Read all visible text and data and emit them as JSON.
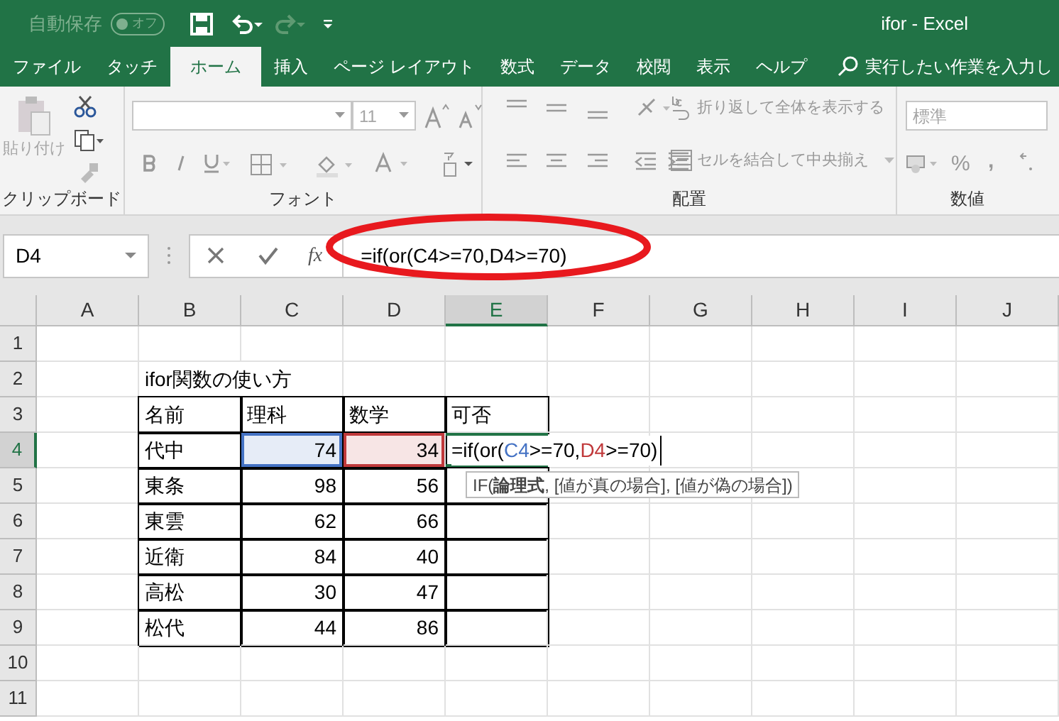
{
  "title_bar": {
    "autosave_label": "自動保存",
    "autosave_toggle": {
      "label": "オフ",
      "on": false
    },
    "redo_disabled": true,
    "title": "ifor  -  Excel"
  },
  "tabs": [
    {
      "label": "ファイル",
      "selected": false
    },
    {
      "label": "タッチ",
      "selected": false
    },
    {
      "label": "ホーム",
      "selected": true
    },
    {
      "label": "挿入",
      "selected": false
    },
    {
      "label": "ページ レイアウト",
      "selected": false
    },
    {
      "label": "数式",
      "selected": false
    },
    {
      "label": "データ",
      "selected": false
    },
    {
      "label": "校閲",
      "selected": false
    },
    {
      "label": "表示",
      "selected": false
    },
    {
      "label": "ヘルプ",
      "selected": false
    }
  ],
  "search": {
    "placeholder": "実行したい作業を入力し"
  },
  "ribbon": {
    "paste_label": "貼り付け",
    "font_size": "11",
    "wrap_text": "折り返して全体を表示する",
    "merge_center": "セルを結合して中央揃え",
    "number_format": "標準",
    "percent": "%",
    "comma": ",",
    "groups": [
      "クリップボード",
      "フォント",
      "配置",
      "数値"
    ]
  },
  "formula_bar": {
    "name_box": "D4",
    "fx": "fx",
    "formula": "=if(or(C4>=70,D4>=70)"
  },
  "columns": [
    {
      "label": "A",
      "selected": false
    },
    {
      "label": "B",
      "selected": false
    },
    {
      "label": "C",
      "selected": false
    },
    {
      "label": "D",
      "selected": false
    },
    {
      "label": "E",
      "selected": true
    },
    {
      "label": "F",
      "selected": false
    },
    {
      "label": "G",
      "selected": false
    },
    {
      "label": "H",
      "selected": false
    },
    {
      "label": "I",
      "selected": false
    },
    {
      "label": "J",
      "selected": false
    }
  ],
  "rows": [
    {
      "label": "1",
      "selected": false,
      "cells": []
    },
    {
      "label": "2",
      "selected": false,
      "cells": [
        {
          "kind": "blank"
        },
        {
          "kind": "text",
          "text": "ifor関数の使い方"
        }
      ]
    },
    {
      "label": "3",
      "selected": false,
      "cells": [
        {
          "kind": "blank"
        },
        {
          "kind": "text",
          "text": "名前",
          "boxed": true
        },
        {
          "kind": "text",
          "text": "理科",
          "boxed": true
        },
        {
          "kind": "text",
          "text": "数学",
          "boxed": true
        },
        {
          "kind": "text",
          "text": "可否",
          "boxed": true
        }
      ]
    },
    {
      "label": "4",
      "selected": true,
      "cells": [
        {
          "kind": "blank"
        },
        {
          "kind": "text",
          "text": "代中",
          "boxed": true
        },
        {
          "kind": "number",
          "text": "74",
          "boxed": true,
          "color": "#4472c4"
        },
        {
          "kind": "number",
          "text": "34",
          "boxed": true,
          "color": "#c0393b"
        },
        {
          "kind": "editing",
          "boxed": true,
          "active": true,
          "segments": [
            {
              "text": "=if(or("
            },
            {
              "text": "C4",
              "color": "#4472c4"
            },
            {
              "text": ">=70,"
            },
            {
              "text": "D4",
              "color": "#c0393b"
            },
            {
              "text": ">=70)"
            }
          ]
        }
      ]
    },
    {
      "label": "5",
      "selected": false,
      "cells": [
        {
          "kind": "blank"
        },
        {
          "kind": "text",
          "text": "東条",
          "boxed": true
        },
        {
          "kind": "number",
          "text": "98",
          "boxed": true
        },
        {
          "kind": "number",
          "text": "56",
          "boxed": true
        },
        {
          "kind": "blank",
          "boxed": true
        }
      ]
    },
    {
      "label": "6",
      "selected": false,
      "cells": [
        {
          "kind": "blank"
        },
        {
          "kind": "text",
          "text": "東雲",
          "boxed": true
        },
        {
          "kind": "number",
          "text": "62",
          "boxed": true
        },
        {
          "kind": "number",
          "text": "66",
          "boxed": true
        },
        {
          "kind": "blank",
          "boxed": true
        }
      ]
    },
    {
      "label": "7",
      "selected": false,
      "cells": [
        {
          "kind": "blank"
        },
        {
          "kind": "text",
          "text": "近衛",
          "boxed": true
        },
        {
          "kind": "number",
          "text": "84",
          "boxed": true
        },
        {
          "kind": "number",
          "text": "40",
          "boxed": true
        },
        {
          "kind": "blank",
          "boxed": true
        }
      ]
    },
    {
      "label": "8",
      "selected": false,
      "cells": [
        {
          "kind": "blank"
        },
        {
          "kind": "text",
          "text": "高松",
          "boxed": true
        },
        {
          "kind": "number",
          "text": "30",
          "boxed": true
        },
        {
          "kind": "number",
          "text": "47",
          "boxed": true
        },
        {
          "kind": "blank",
          "boxed": true
        }
      ]
    },
    {
      "label": "9",
      "selected": false,
      "cells": [
        {
          "kind": "blank"
        },
        {
          "kind": "text",
          "text": "松代",
          "boxed": true
        },
        {
          "kind": "number",
          "text": "44",
          "boxed": true
        },
        {
          "kind": "number",
          "text": "86",
          "boxed": true
        },
        {
          "kind": "blank",
          "boxed": true
        }
      ]
    },
    {
      "label": "10",
      "selected": false,
      "cells": []
    },
    {
      "label": "11",
      "selected": false,
      "cells": []
    }
  ],
  "tooltip": "IF(**論理式**, [値が真の場合], [値が偽の場合])"
}
